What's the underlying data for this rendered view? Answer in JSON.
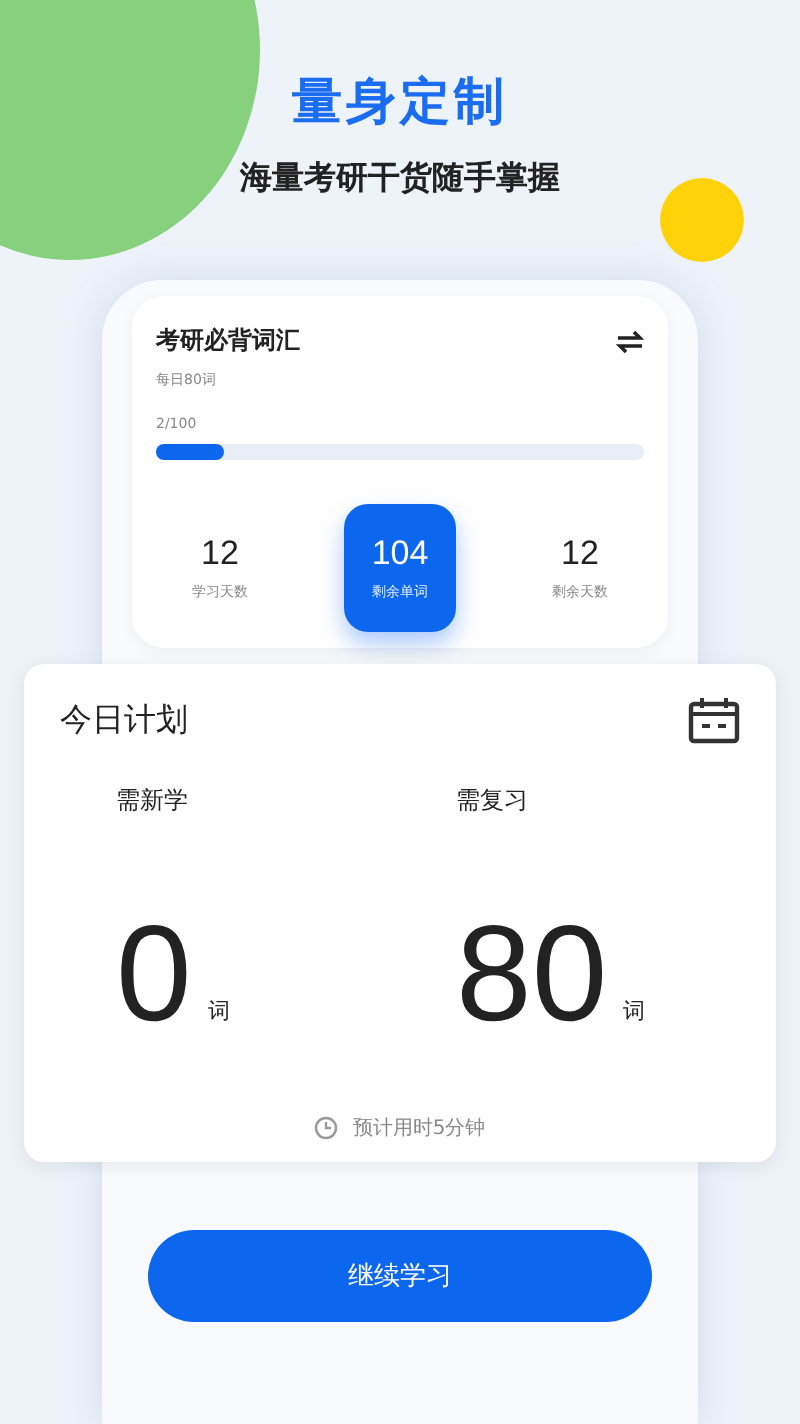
{
  "header": {
    "title": "量身定制",
    "subtitle": "海量考研干货随手掌握"
  },
  "book": {
    "title": "考研必背词汇",
    "daily": "每日80词",
    "progress_text": "2/100",
    "level": 0.14
  },
  "stats": [
    {
      "value": "12",
      "label": "学习天数",
      "selected": false
    },
    {
      "value": "104",
      "label": "剩余单词",
      "selected": true
    },
    {
      "value": "12",
      "label": "剩余天数",
      "selected": false
    }
  ],
  "plan": {
    "title": "今日计划",
    "items": [
      {
        "label": "需新学",
        "count": "0",
        "unit": "词"
      },
      {
        "label": "需复习",
        "count": "80",
        "unit": "词"
      }
    ],
    "estimate": "预计用时5分钟"
  },
  "button": "继续学习"
}
